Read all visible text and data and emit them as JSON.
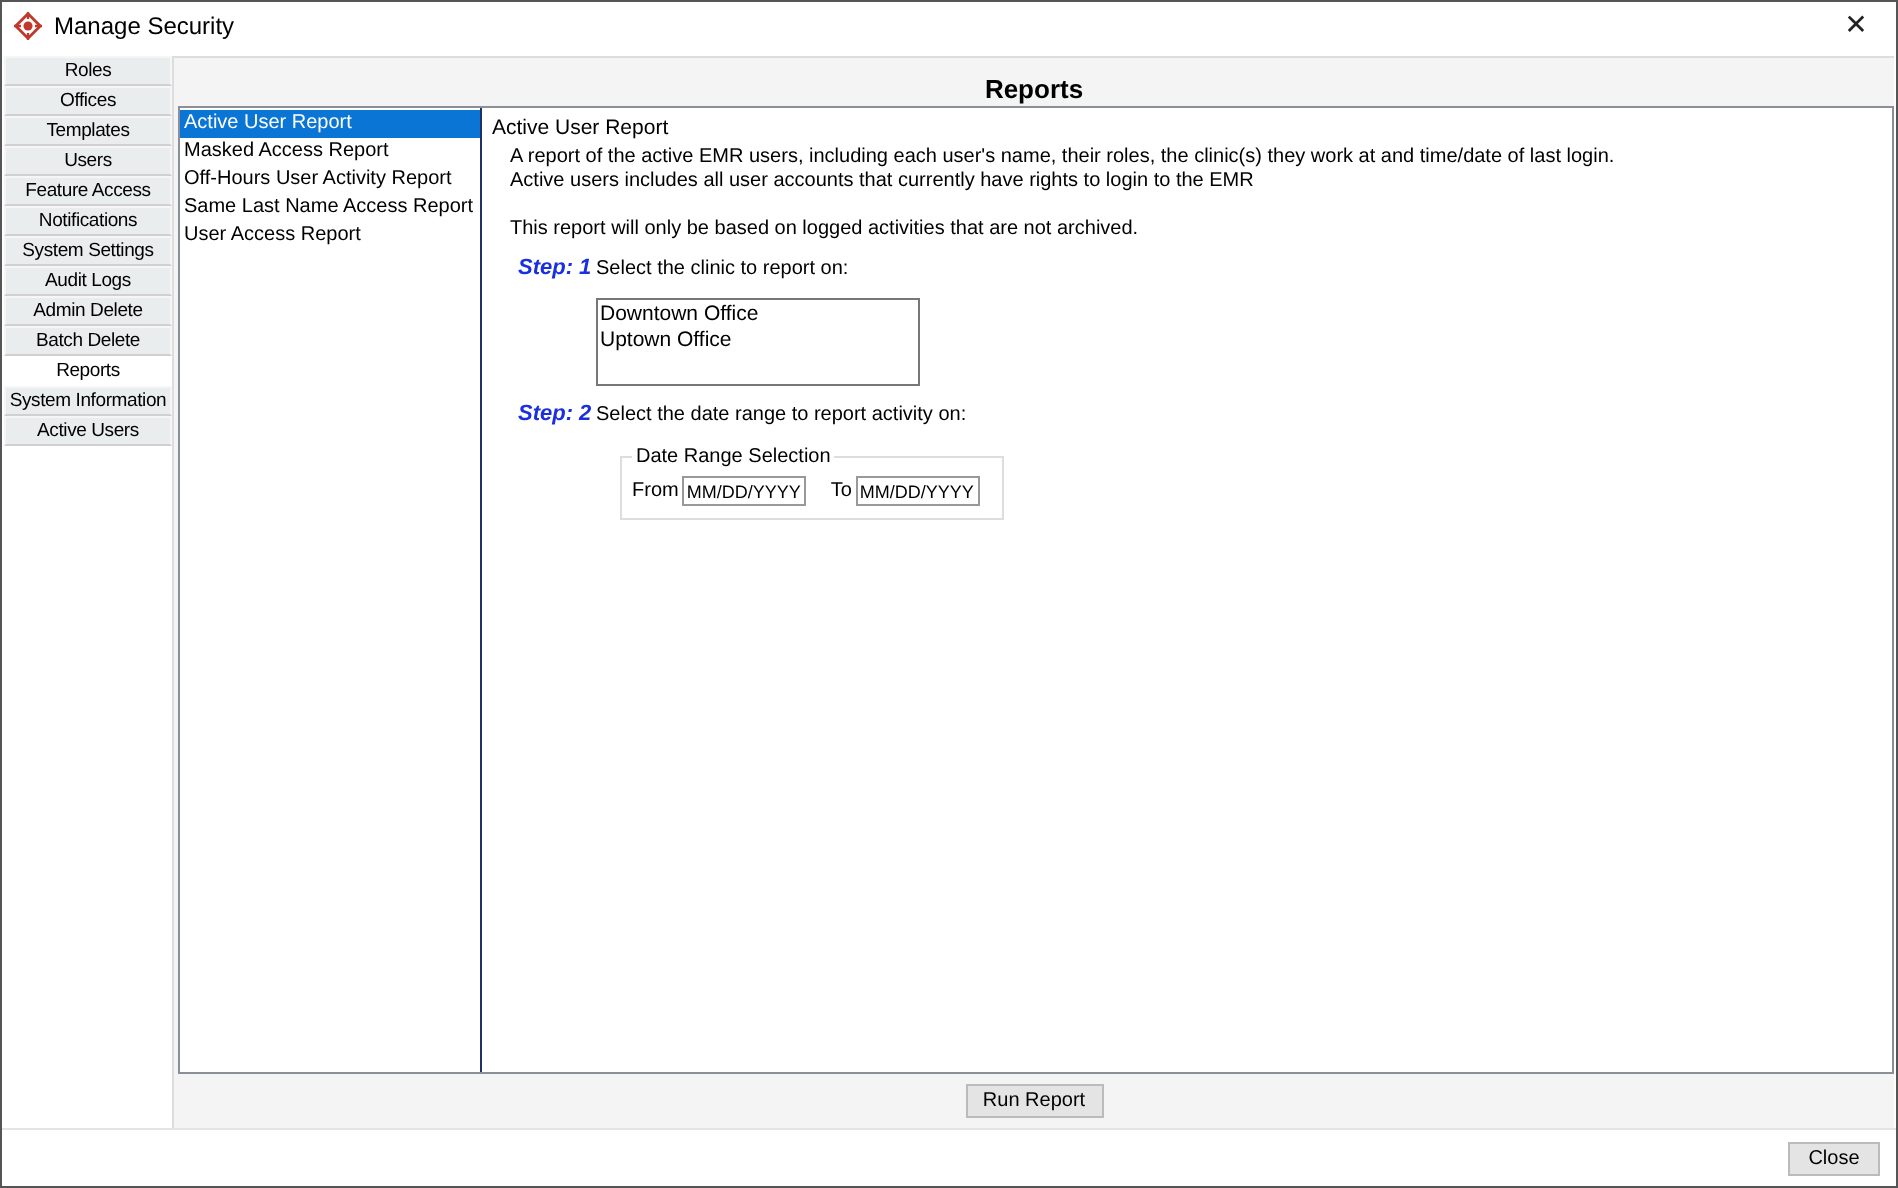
{
  "window": {
    "title": "Manage Security",
    "close": "✕"
  },
  "nav": [
    {
      "label": "Roles",
      "selected": false
    },
    {
      "label": "Offices",
      "selected": false
    },
    {
      "label": "Templates",
      "selected": false
    },
    {
      "label": "Users",
      "selected": false
    },
    {
      "label": "Feature Access",
      "selected": false
    },
    {
      "label": "Notifications",
      "selected": false
    },
    {
      "label": "System Settings",
      "selected": false
    },
    {
      "label": "Audit Logs",
      "selected": false
    },
    {
      "label": "Admin Delete",
      "selected": false
    },
    {
      "label": "Batch Delete",
      "selected": false
    },
    {
      "label": "Reports",
      "selected": true
    },
    {
      "label": "System Information",
      "selected": false
    },
    {
      "label": "Active Users",
      "selected": false
    }
  ],
  "panel_title": "Reports",
  "reports": [
    {
      "label": "Active User Report",
      "selected": true
    },
    {
      "label": "Masked Access Report",
      "selected": false
    },
    {
      "label": "Off-Hours User Activity Report",
      "selected": false
    },
    {
      "label": "Same Last Name Access Report",
      "selected": false
    },
    {
      "label": "User Access Report",
      "selected": false
    }
  ],
  "detail": {
    "heading": "Active User Report",
    "description": [
      "A report of the active EMR users, including each user's name, their roles, the clinic(s) they work at and time/date of last login.",
      "Active users includes all user accounts that currently have rights to login to the EMR"
    ],
    "note": "This report will only be based on logged activities that are not archived.",
    "step1": {
      "label": "Step: 1",
      "text": "Select the clinic to report on:"
    },
    "clinics": [
      {
        "label": "Downtown Office",
        "selected": false
      },
      {
        "label": "Uptown Office",
        "selected": false
      }
    ],
    "step2": {
      "label": "Step: 2",
      "text": "Select the date range to report activity on:"
    },
    "date_range": {
      "legend": "Date Range Selection",
      "from_label": "From",
      "from_placeholder": "MM/DD/YYYY",
      "to_label": "To",
      "to_placeholder": "MM/DD/YYYY"
    }
  },
  "run_button": "Run Report",
  "close_button": "Close"
}
